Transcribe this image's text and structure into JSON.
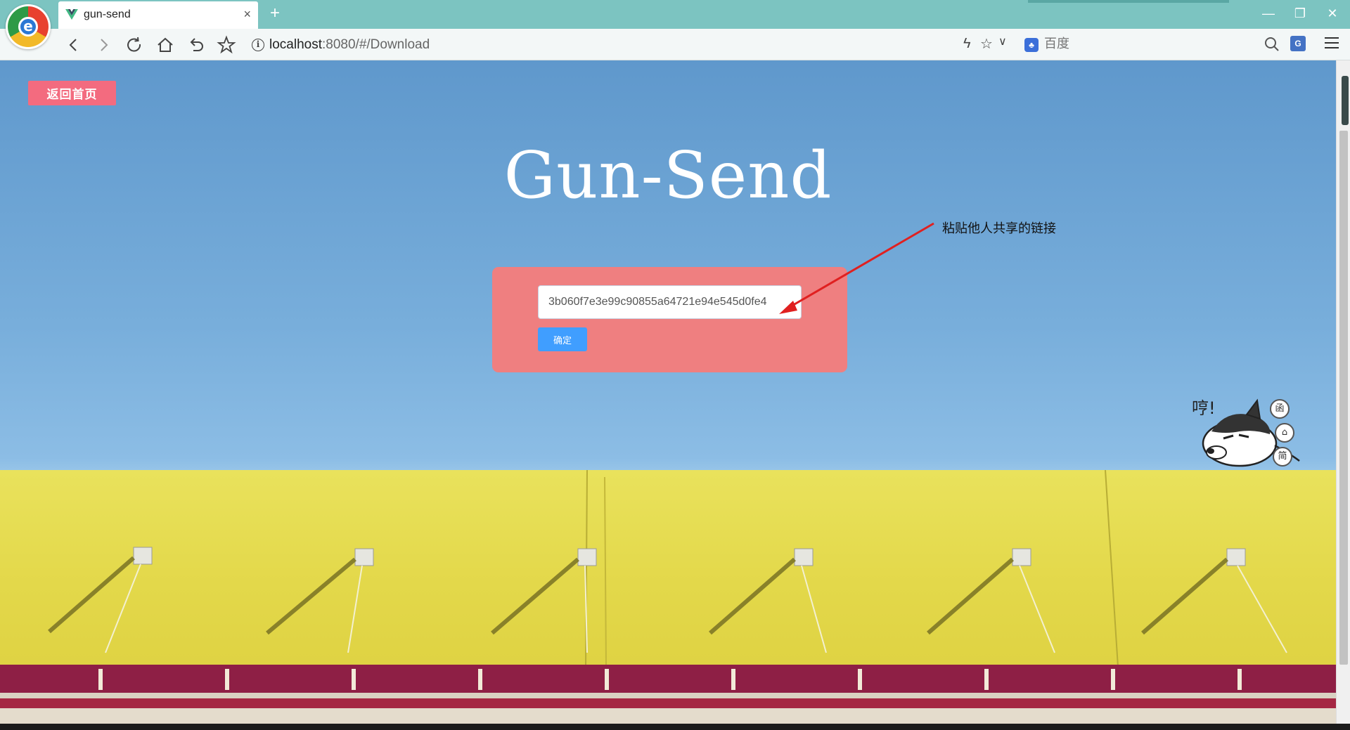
{
  "browser": {
    "tab_title": "gun-send",
    "tab_close": "×",
    "new_tab": "+",
    "window_controls": {
      "minimize": "—",
      "restore": "❐",
      "close": "✕"
    },
    "url_host": "localhost",
    "url_rest": ":8080/#/Download",
    "search_placeholder": "百度",
    "search_engine_icon": "baidu-icon",
    "icons": [
      "back-icon",
      "forward-icon",
      "reload-icon",
      "home-icon",
      "undo-icon",
      "bookmark-star-icon",
      "lightning-icon",
      "favorite-star-icon",
      "chevron-down-icon",
      "search-icon",
      "translate-icon",
      "menu-icon"
    ]
  },
  "page": {
    "home_button": "返回首页",
    "title": "Gun-Send",
    "link_input_value": "3b060f7e3e99c90855a64721e94e545d0fe4",
    "confirm_button": "确定",
    "annotation": "粘贴他人共享的链接",
    "mascot_shout": "哼!",
    "paw_buttons": [
      "函",
      "⌂",
      "简"
    ]
  },
  "colors": {
    "tab_bar": "#7cc4c1",
    "home_button": "#f36b7f",
    "card": "#ef7f80",
    "confirm_button": "#409eff",
    "sky": "#78aedb",
    "wall": "#e3d84a",
    "awning": "#8e1f45",
    "arrow": "#e02020"
  }
}
